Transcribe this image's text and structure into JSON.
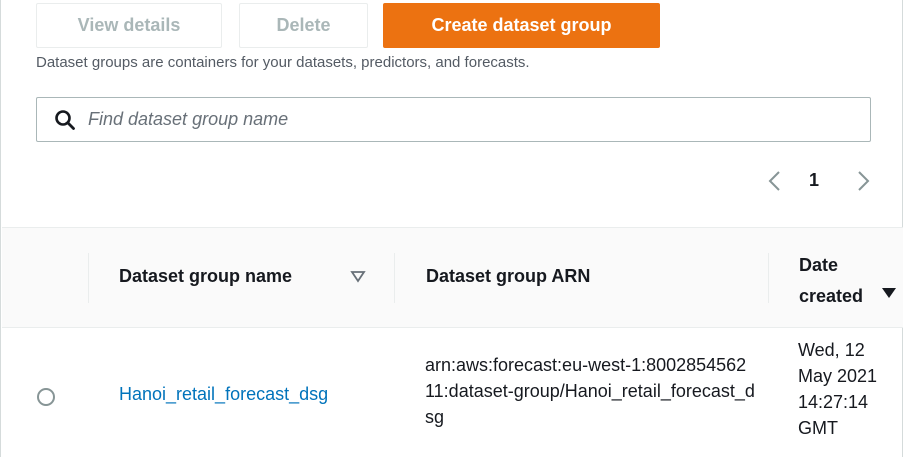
{
  "toolbar": {
    "view_details_label": "View details",
    "delete_label": "Delete",
    "create_label": "Create dataset group"
  },
  "description": "Dataset groups are containers for your datasets, predictors, and forecasts.",
  "search": {
    "placeholder": "Find dataset group name",
    "value": ""
  },
  "pagination": {
    "current_page": "1"
  },
  "table": {
    "columns": [
      {
        "label": "Dataset group name",
        "sort": "sortable"
      },
      {
        "label": "Dataset group ARN"
      },
      {
        "label": "Date created",
        "sort": "descending"
      }
    ],
    "rows": [
      {
        "name": "Hanoi_retail_forecast_dsg",
        "arn": "arn:aws:forecast:eu-west-1:800285456211:dataset-group/Hanoi_retail_forecast_dsg",
        "date_created": "Wed, 12 May 2021 14:27:14 GMT",
        "selected": false
      }
    ]
  },
  "colors": {
    "primary": "#ec7211",
    "link": "#0073bb",
    "disabled_text": "#aab7b8"
  },
  "icons": [
    "search-icon",
    "chevron-left-icon",
    "chevron-right-icon",
    "sort-icon",
    "sort-descending-icon"
  ]
}
